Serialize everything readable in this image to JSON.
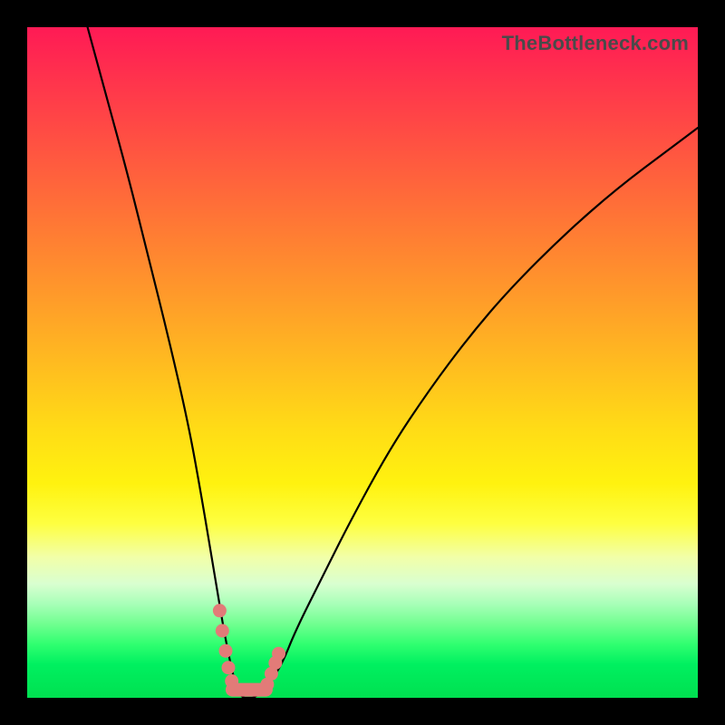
{
  "watermark": "TheBottleneck.com",
  "chart_data": {
    "type": "line",
    "title": "",
    "xlabel": "",
    "ylabel": "",
    "xlim": [
      0,
      100
    ],
    "ylim": [
      0,
      100
    ],
    "grid": false,
    "series": [
      {
        "name": "bottleneck-curve",
        "x": [
          9,
          12,
          15,
          18,
          21,
          24,
          26,
          28,
          29.5,
          31,
          32,
          33,
          34,
          36,
          38,
          40,
          44,
          48,
          54,
          60,
          66,
          72,
          80,
          88,
          96,
          100
        ],
        "values": [
          100,
          89,
          78,
          66,
          54,
          41,
          30,
          18,
          9,
          2,
          0,
          0,
          0,
          2,
          5,
          10,
          18,
          26,
          37,
          46,
          54,
          61,
          69,
          76,
          82,
          85
        ]
      }
    ],
    "salmon_highlight": {
      "name": "optimal-zone-marker",
      "color": "#e27b78",
      "points_left": [
        [
          28.7,
          13
        ],
        [
          29.1,
          10
        ],
        [
          29.6,
          7
        ],
        [
          30.0,
          4.5
        ],
        [
          30.5,
          2.5
        ]
      ],
      "baseline_y": 1.2,
      "baseline_x_range": [
        30.6,
        35.6
      ],
      "points_right": [
        [
          35.8,
          2.0
        ],
        [
          36.4,
          3.6
        ],
        [
          37.0,
          5.2
        ],
        [
          37.5,
          6.6
        ]
      ]
    }
  }
}
